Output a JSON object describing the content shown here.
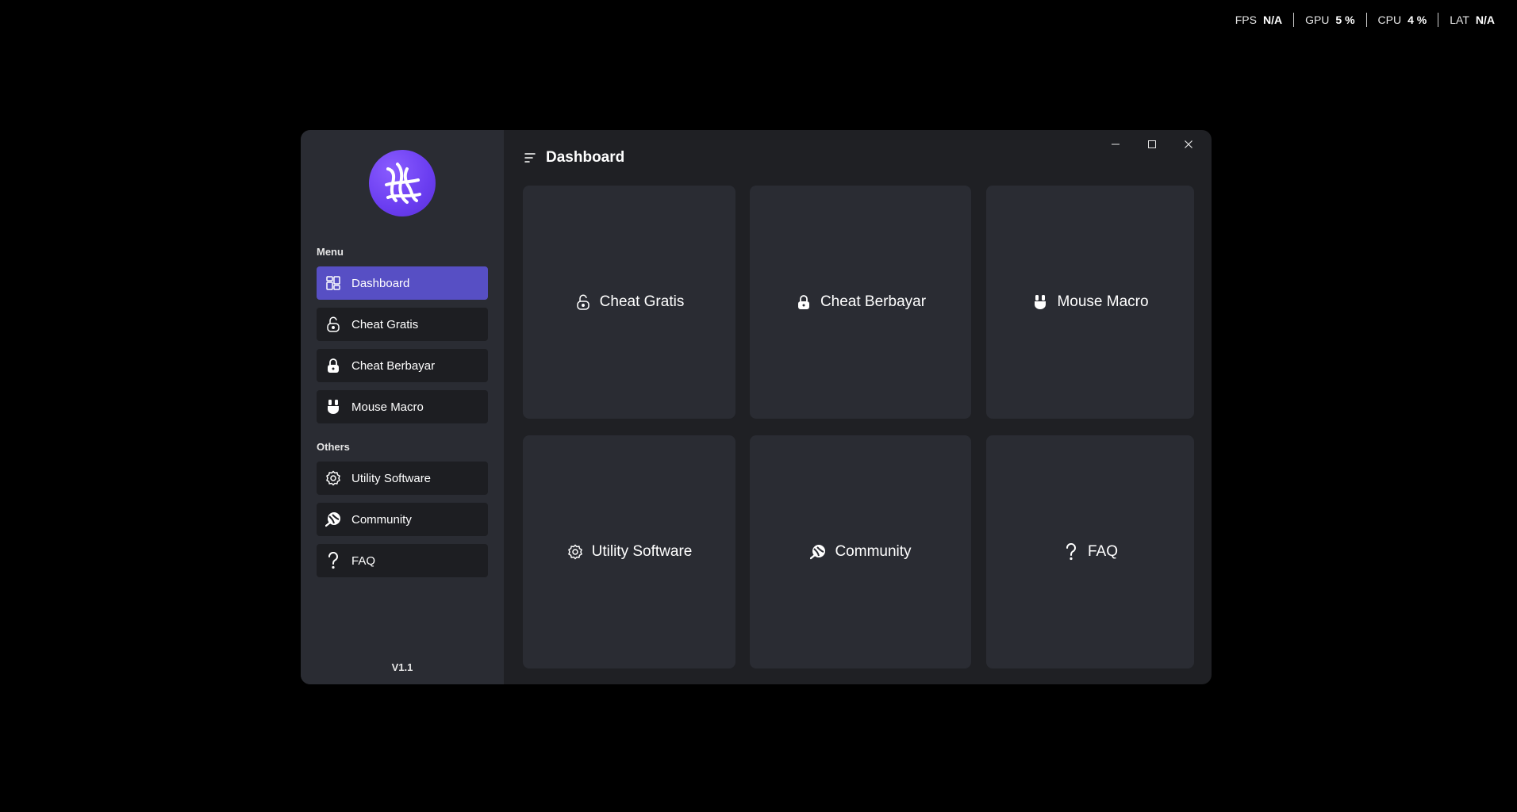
{
  "perf": {
    "fps": {
      "label": "FPS",
      "value": "N/A"
    },
    "gpu": {
      "label": "GPU",
      "value": "5 %"
    },
    "cpu": {
      "label": "CPU",
      "value": "4 %"
    },
    "lat": {
      "label": "LAT",
      "value": "N/A"
    }
  },
  "sidebar": {
    "menu_label": "Menu",
    "menu_items": [
      {
        "label": "Dashboard",
        "icon": "dashboard-icon",
        "active": true
      },
      {
        "label": "Cheat Gratis",
        "icon": "unlock-icon"
      },
      {
        "label": "Cheat Berbayar",
        "icon": "lock-icon"
      },
      {
        "label": "Mouse Macro",
        "icon": "mouse-icon"
      }
    ],
    "others_label": "Others",
    "others_items": [
      {
        "label": "Utility Software",
        "icon": "gear-icon"
      },
      {
        "label": "Community",
        "icon": "community-icon"
      },
      {
        "label": "FAQ",
        "icon": "question-icon"
      }
    ],
    "version": "V1.1"
  },
  "header": {
    "title": "Dashboard"
  },
  "cards": [
    {
      "label": "Cheat Gratis",
      "icon": "unlock-icon"
    },
    {
      "label": "Cheat Berbayar",
      "icon": "lock-icon"
    },
    {
      "label": "Mouse Macro",
      "icon": "mouse-icon"
    },
    {
      "label": "Utility Software",
      "icon": "gear-icon"
    },
    {
      "label": "Community",
      "icon": "community-icon"
    },
    {
      "label": "FAQ",
      "icon": "question-icon"
    }
  ],
  "colors": {
    "accent": "#574fc4",
    "sidebar_bg": "#2a2c33",
    "window_bg": "#1f2024",
    "card_bg": "#2a2c33"
  }
}
